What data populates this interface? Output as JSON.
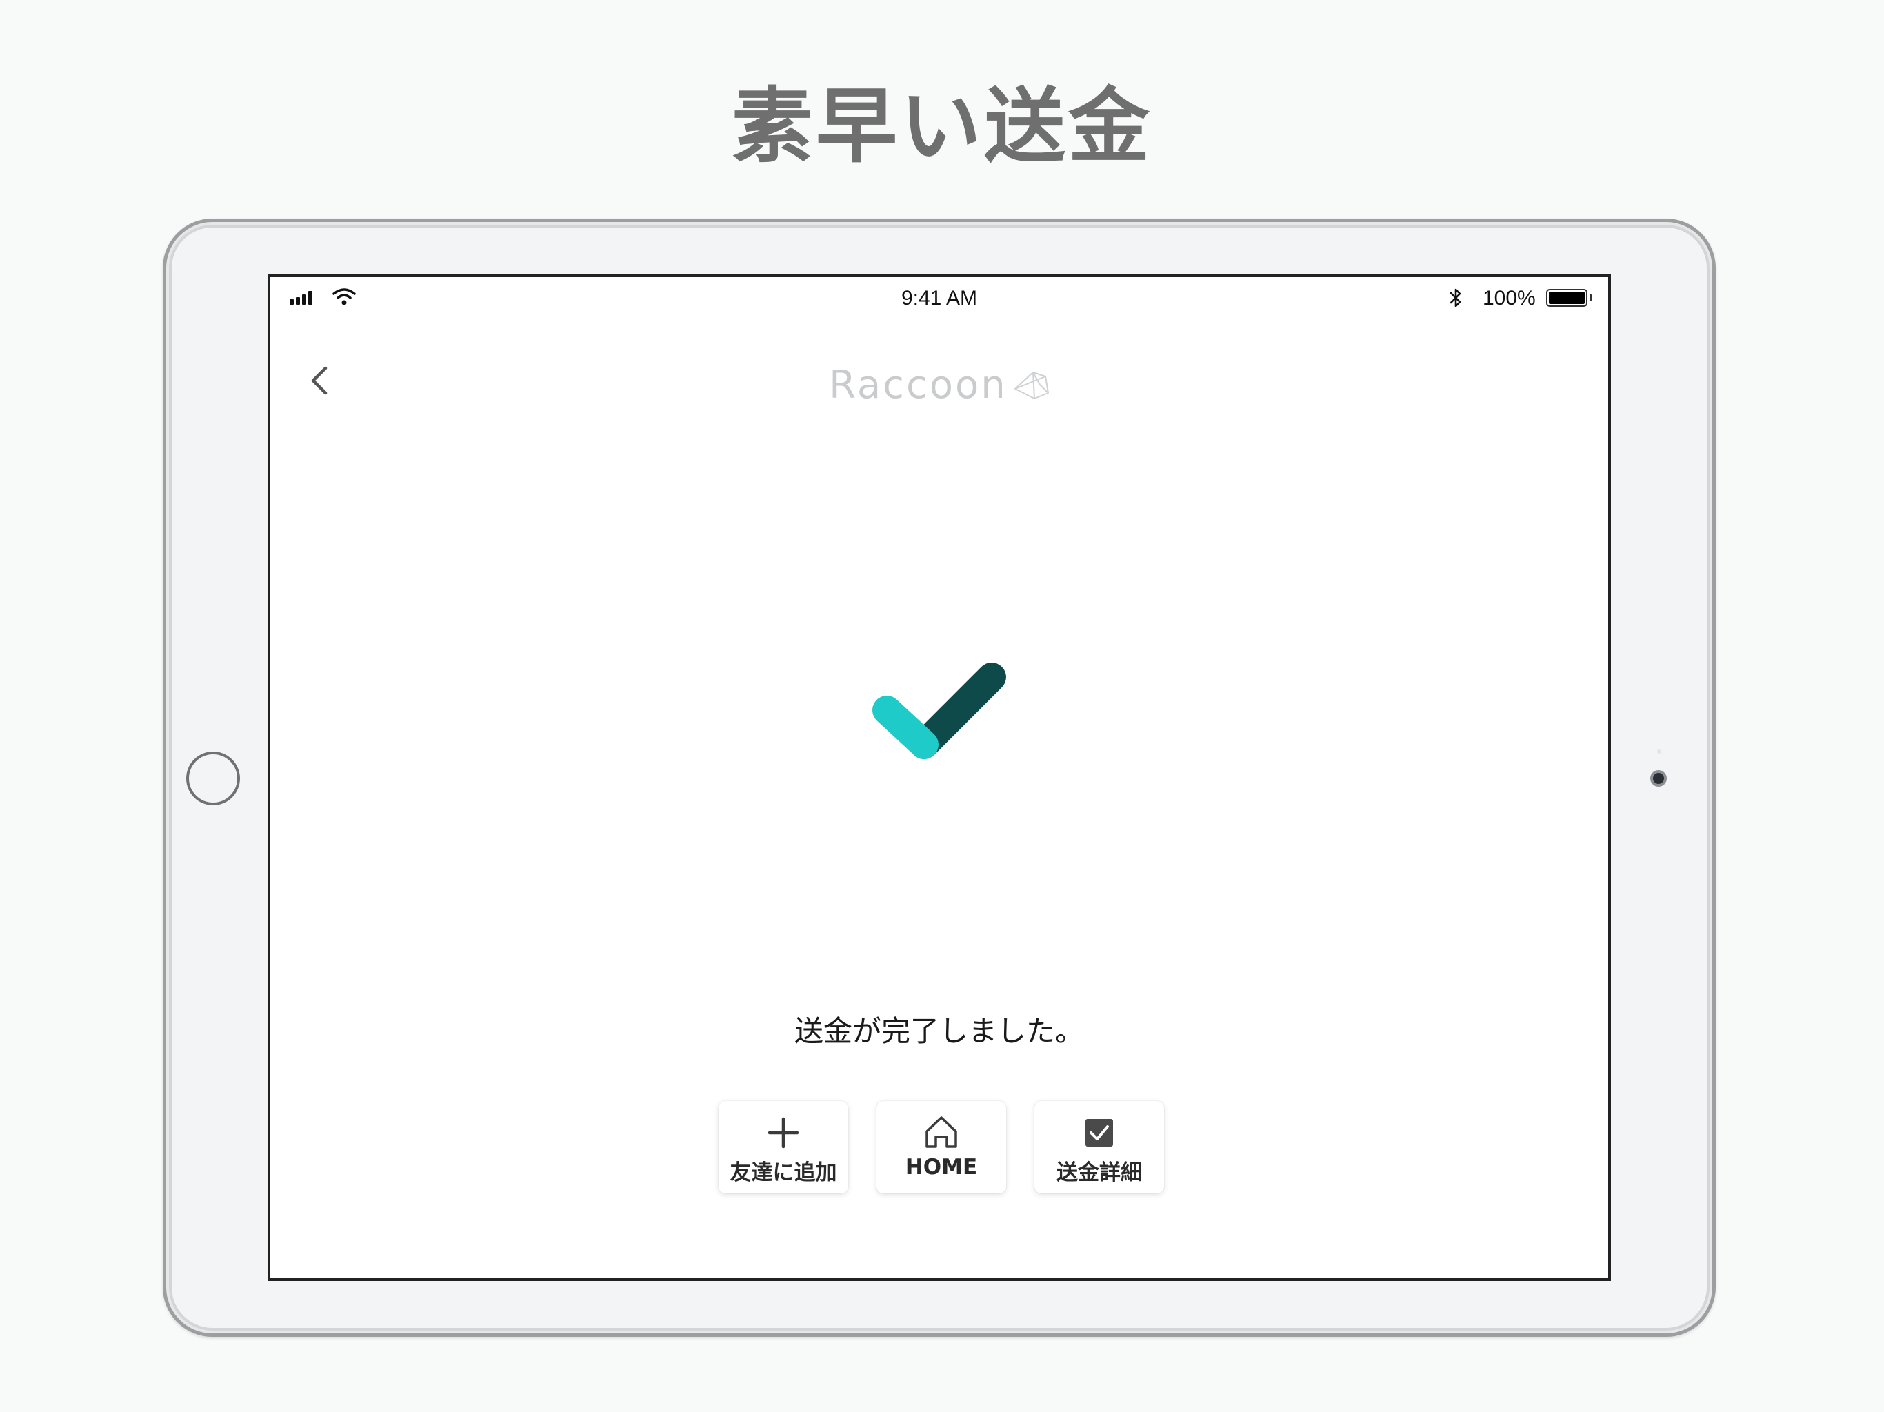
{
  "headline": "素早い送金",
  "status_bar": {
    "time": "9:41 AM",
    "battery_percent": "100%",
    "battery_level": 1.0,
    "icons": [
      "signal-icon",
      "wifi-icon",
      "bluetooth-icon",
      "battery-icon"
    ]
  },
  "nav": {
    "logo_text": "Raccoon",
    "back_icon": "chevron-left-icon"
  },
  "result": {
    "message": "送金が完了しました。",
    "check_colors": {
      "short_stroke": "#1ecbc8",
      "long_stroke": "#0e4a4a"
    }
  },
  "actions": [
    {
      "label": "友達に追加",
      "icon": "plus-icon"
    },
    {
      "label": "HOME",
      "icon": "home-icon"
    },
    {
      "label": "送金詳細",
      "icon": "checkbox-icon"
    }
  ]
}
